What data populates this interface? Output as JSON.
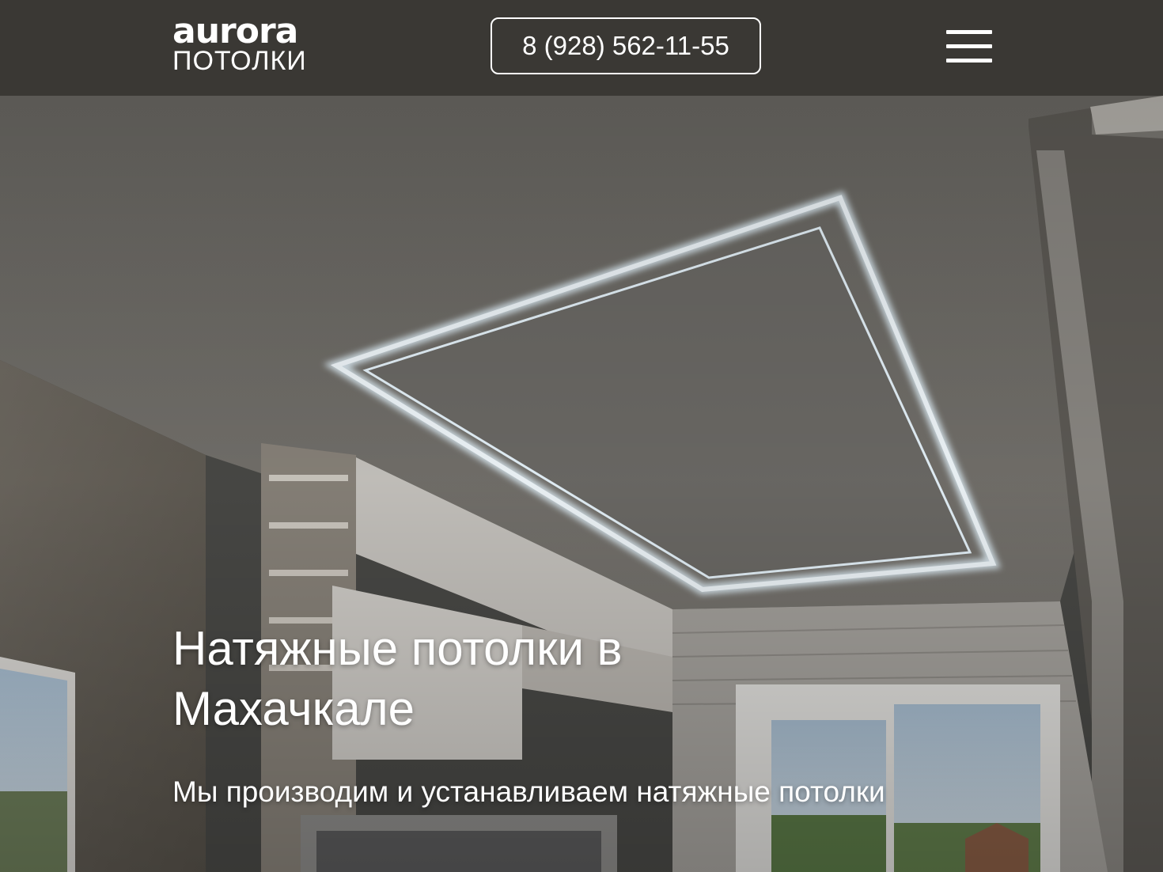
{
  "header": {
    "logo": {
      "main": "aurora",
      "sub": "ПОТОЛКИ"
    },
    "phone_label": "8 (928) 562-11-55",
    "menu_icon": "hamburger-menu-icon"
  },
  "hero": {
    "title": "Натяжные потолки в Махачкале",
    "subtitle": "Мы производим и устанавливаем натяжные потолки",
    "image_description_icon": "ceiling-photo"
  },
  "colors": {
    "header_bg": "#3a3834",
    "text": "#ffffff",
    "ceiling_glow": "#dff3ff"
  }
}
